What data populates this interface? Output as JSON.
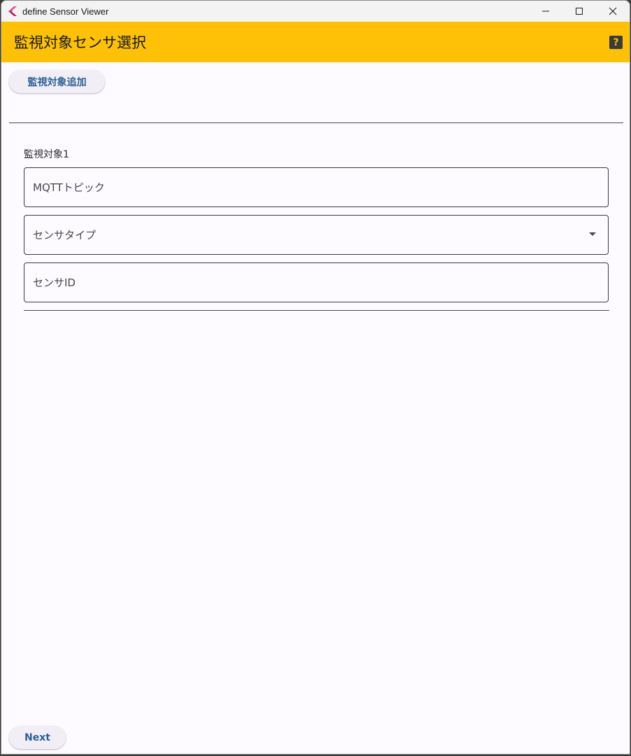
{
  "window": {
    "title": "define Sensor Viewer"
  },
  "appbar": {
    "title": "監視対象センサ選択",
    "help_label": "?",
    "color": "#ffc107"
  },
  "actions": {
    "add_label": "監視対象追加",
    "next_label": "Next"
  },
  "targets": [
    {
      "label": "監視対象1",
      "mqtt_topic_placeholder": "MQTTトピック",
      "sensor_type_placeholder": "センサタイプ",
      "sensor_id_placeholder": "センサID"
    }
  ],
  "icons": {
    "app": "flutter-icon",
    "minimize": "minimize-icon",
    "maximize": "maximize-icon",
    "close": "close-icon",
    "help": "help-icon",
    "dropdown": "dropdown-arrow-icon"
  }
}
